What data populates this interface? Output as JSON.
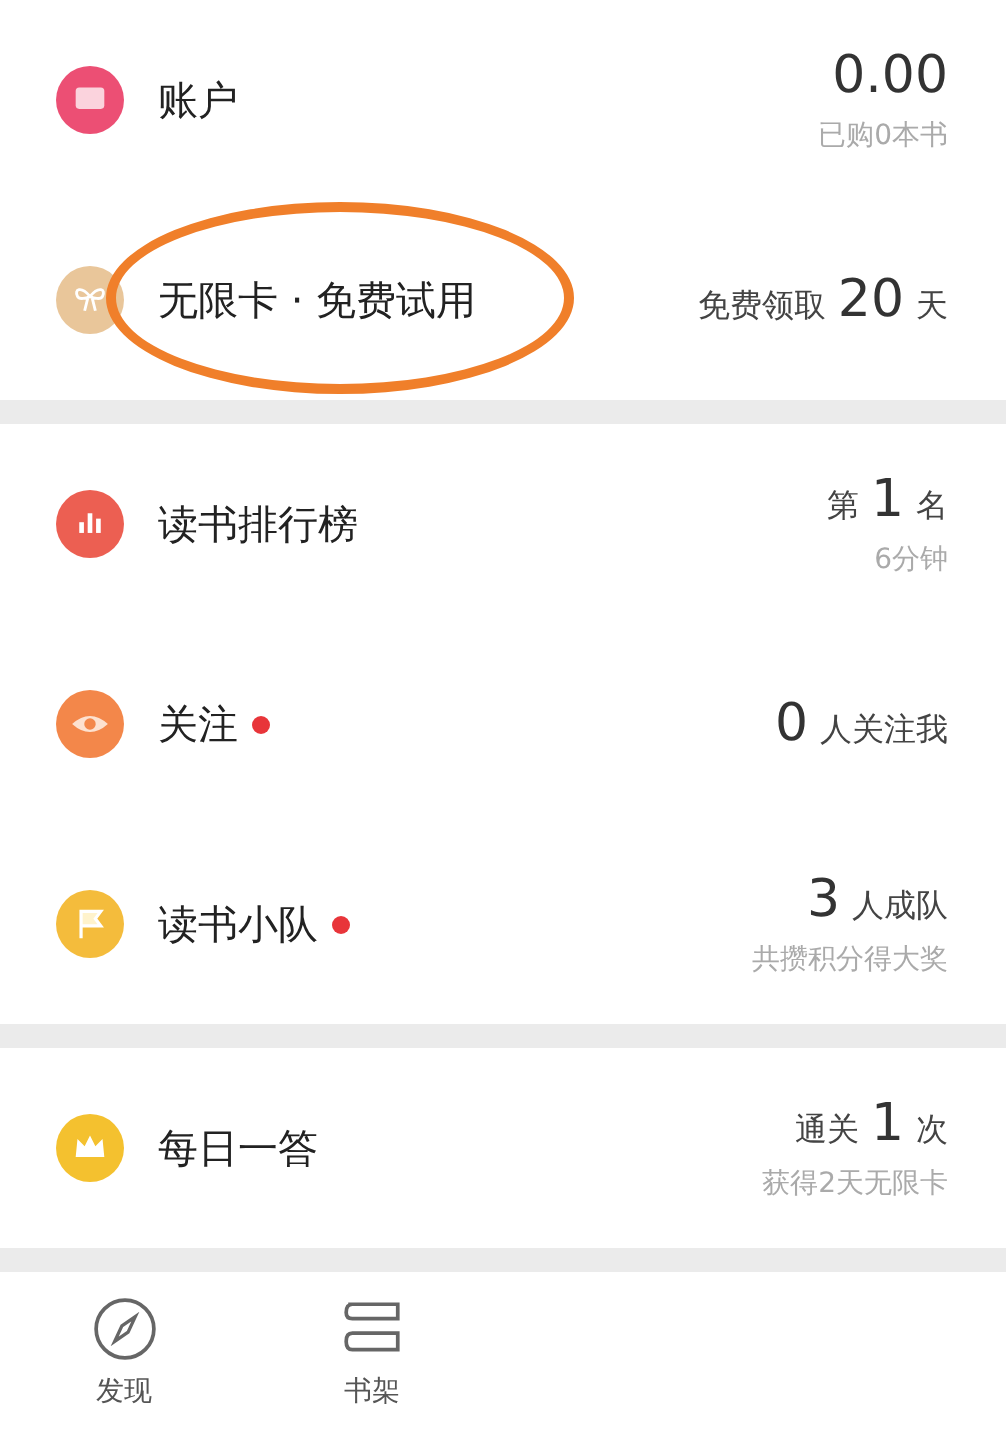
{
  "sections": [
    {
      "rows": [
        {
          "kind": "wallet",
          "color": "#ec4f74",
          "title": "账户",
          "dot": false,
          "circled": false,
          "value": [
            {
              "kind": "number",
              "text": "0.00"
            }
          ],
          "sub": "已购0本书"
        },
        {
          "kind": "bow",
          "color": "#e9c69a",
          "title": "无限卡 · 免费试用",
          "dot": false,
          "circled": true,
          "value": [
            {
              "kind": "unit",
              "text": "免费领取"
            },
            {
              "kind": "number",
              "text": "20"
            },
            {
              "kind": "unit",
              "text": "天"
            }
          ]
        }
      ]
    },
    {
      "rows": [
        {
          "kind": "chart",
          "color": "#ec5f52",
          "title": "读书排行榜",
          "dot": false,
          "circled": false,
          "value": [
            {
              "kind": "unit",
              "text": "第"
            },
            {
              "kind": "number",
              "text": "1"
            },
            {
              "kind": "unit",
              "text": "名"
            }
          ],
          "sub": "6分钟"
        },
        {
          "kind": "eye",
          "color": "#f3874a",
          "title": "关注",
          "dot": true,
          "circled": false,
          "value": [
            {
              "kind": "number",
              "text": "0"
            },
            {
              "kind": "unit",
              "text": "人关注我"
            }
          ]
        },
        {
          "kind": "flag",
          "color": "#f4bc3c",
          "title": "读书小队",
          "dot": true,
          "circled": false,
          "value": [
            {
              "kind": "number",
              "text": "3"
            },
            {
              "kind": "unit",
              "text": "人成队"
            }
          ],
          "sub": "共攒积分得大奖"
        }
      ]
    },
    {
      "rows": [
        {
          "kind": "crown",
          "color": "#f4c12f",
          "title": "每日一答",
          "dot": false,
          "circled": false,
          "value": [
            {
              "kind": "unit",
              "text": "通关"
            },
            {
              "kind": "number",
              "text": "1"
            },
            {
              "kind": "unit",
              "text": "次"
            }
          ],
          "sub": "获得2天无限卡"
        }
      ]
    }
  ],
  "nav": [
    {
      "kind": "compass",
      "label": "发现"
    },
    {
      "kind": "books",
      "label": "书架"
    }
  ]
}
